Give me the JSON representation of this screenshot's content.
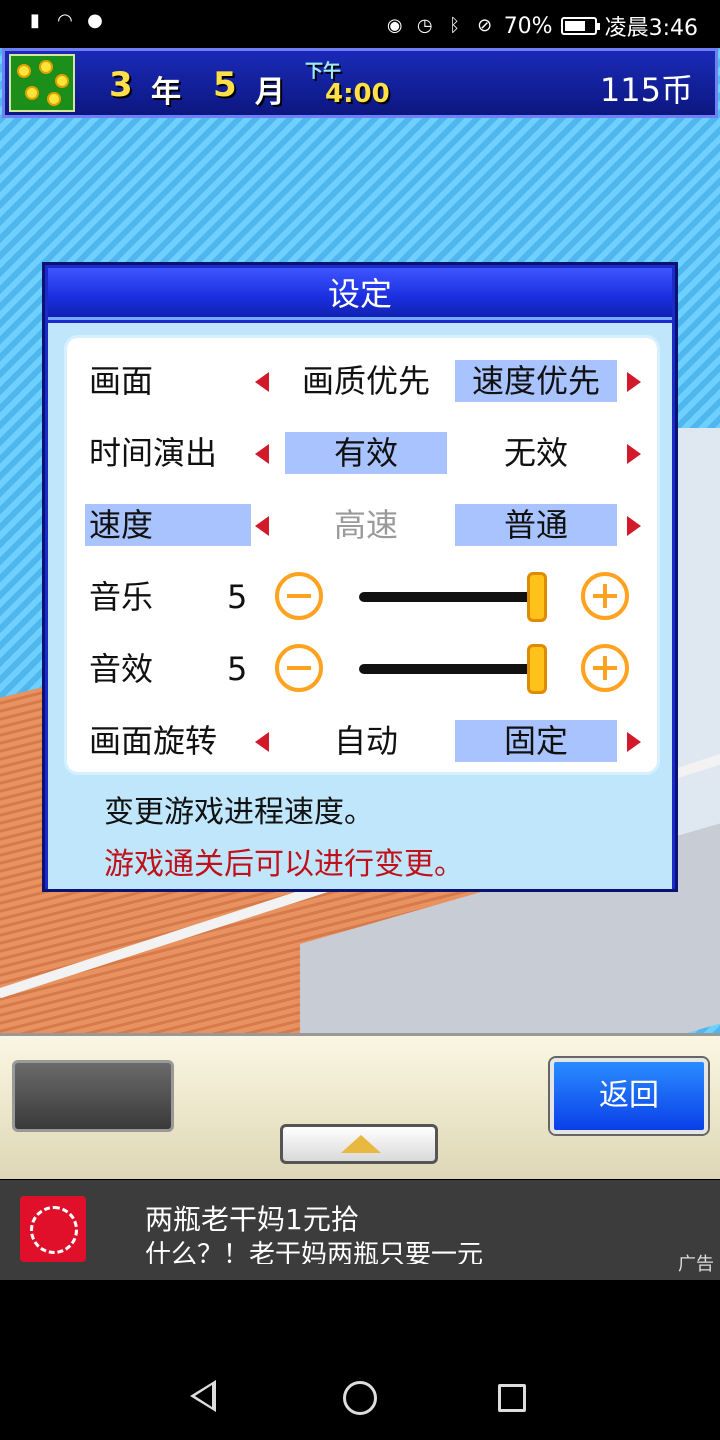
{
  "status_bar": {
    "battery": "70%",
    "battery_level": 0.7,
    "time": "凌晨3:46"
  },
  "top_bar": {
    "year_num": "3",
    "year_label": "年",
    "month_num": "5",
    "month_label": "月",
    "ampm": "下午",
    "time": "4:00",
    "coins": "115币"
  },
  "dialog": {
    "title": "设定",
    "rows": {
      "screen": {
        "label": "画面",
        "opt_a": "画质优先",
        "opt_b": "速度优先"
      },
      "time_effect": {
        "label": "时间演出",
        "opt_a": "有效",
        "opt_b": "无效"
      },
      "speed": {
        "label": "速度",
        "opt_a": "高速",
        "opt_b": "普通"
      },
      "music": {
        "label": "音乐",
        "value": "5",
        "level": 1.0
      },
      "sfx": {
        "label": "音效",
        "value": "5",
        "level": 1.0
      },
      "rotation": {
        "label": "画面旋转",
        "opt_a": "自动",
        "opt_b": "固定"
      }
    },
    "description": "变更游戏进程速度。",
    "note": "游戏通关后可以进行变更。"
  },
  "bottom_bar": {
    "back_label": "返回"
  },
  "ad": {
    "title": "两瓶老干妈1元拾",
    "subtitle": "什么？！老干妈两瓶只要一元",
    "tag": "广告"
  }
}
